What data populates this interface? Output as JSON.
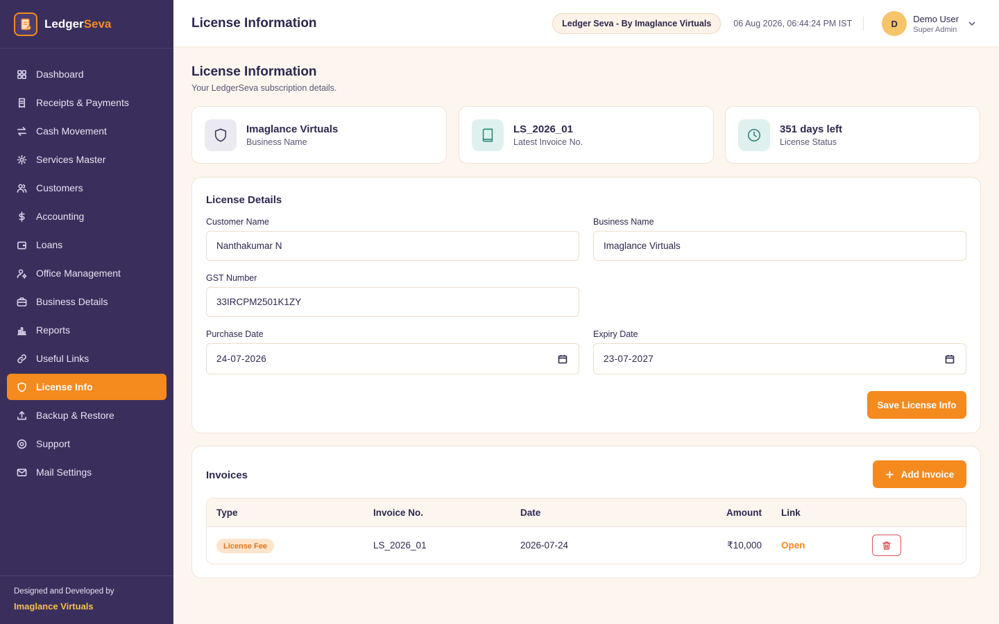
{
  "brand": {
    "name_part1": "Ledger",
    "name_part2": "Seva"
  },
  "sidebar": {
    "items": [
      {
        "label": "Dashboard",
        "icon": "grid-icon"
      },
      {
        "label": "Receipts & Payments",
        "icon": "receipt-icon"
      },
      {
        "label": "Cash Movement",
        "icon": "swap-icon"
      },
      {
        "label": "Services Master",
        "icon": "gear-icon"
      },
      {
        "label": "Customers",
        "icon": "users-icon"
      },
      {
        "label": "Accounting",
        "icon": "dollar-icon"
      },
      {
        "label": "Loans",
        "icon": "wallet-icon"
      },
      {
        "label": "Office Management",
        "icon": "user-cog-icon"
      },
      {
        "label": "Business Details",
        "icon": "briefcase-icon"
      },
      {
        "label": "Reports",
        "icon": "bar-chart-icon"
      },
      {
        "label": "Useful Links",
        "icon": "link-icon"
      },
      {
        "label": "License Info",
        "icon": "shield-icon",
        "active": true
      },
      {
        "label": "Backup & Restore",
        "icon": "upload-icon"
      },
      {
        "label": "Support",
        "icon": "support-icon"
      },
      {
        "label": "Mail Settings",
        "icon": "mail-icon"
      }
    ],
    "footer_caption": "Designed and Developed by",
    "footer_brand": "Imaglance Virtuals"
  },
  "header": {
    "title": "License Information",
    "pill": "Ledger Seva - By Imaglance Virtuals",
    "datetime": "06 Aug 2026, 06:44:24 PM IST",
    "avatar_initial": "D",
    "user_name": "Demo User",
    "user_role": "Super Admin"
  },
  "page": {
    "title": "License Information",
    "subtitle": "Your LedgerSeva subscription details."
  },
  "stats": [
    {
      "value": "Imaglance Virtuals",
      "label": "Business Name",
      "icon": "shield-icon",
      "icon_bg": "#eceaf1",
      "icon_color": "#3a3556"
    },
    {
      "value": "LS_2026_01",
      "label": "Latest Invoice No.",
      "icon": "book-icon",
      "icon_bg": "#dff1ee",
      "icon_color": "#2b8577"
    },
    {
      "value": "351 days left",
      "label": "License Status",
      "icon": "clock-icon",
      "icon_bg": "#dff1ee",
      "icon_color": "#2b8577"
    }
  ],
  "license_details": {
    "title": "License Details",
    "customer_name_label": "Customer Name",
    "customer_name": "Nanthakumar N",
    "business_name_label": "Business Name",
    "business_name": "Imaglance Virtuals",
    "gst_label": "GST Number",
    "gst": "33IRCPM2501K1ZY",
    "purchase_date_label": "Purchase Date",
    "purchase_date": "24-07-2026",
    "expiry_date_label": "Expiry Date",
    "expiry_date": "23-07-2027",
    "save_label": "Save License Info"
  },
  "invoices": {
    "title": "Invoices",
    "add_label": "Add Invoice",
    "columns": {
      "type": "Type",
      "invoice_no": "Invoice No.",
      "date": "Date",
      "amount": "Amount",
      "link": "Link"
    },
    "rows": [
      {
        "type": "License Fee",
        "invoice_no": "LS_2026_01",
        "date": "2026-07-24",
        "amount": "₹10,000",
        "link": "Open"
      }
    ]
  },
  "colors": {
    "sidebar_bg": "#3a2f5c",
    "accent": "#f58a1f",
    "page_bg": "#fdf6ef"
  }
}
